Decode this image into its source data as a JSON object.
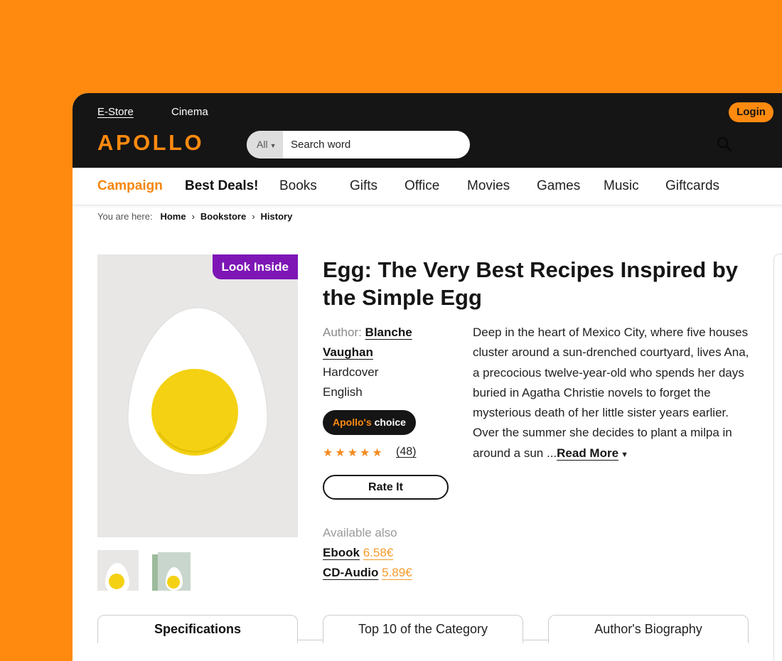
{
  "topbar": {
    "links": [
      "E-Store",
      "Cinema"
    ],
    "login_label": "Login",
    "logo": "APOLLO",
    "search": {
      "scope": "All",
      "placeholder": "Search word"
    }
  },
  "nav": {
    "items": [
      "Campaign",
      "Best Deals!",
      "Books",
      "Gifts",
      "Office",
      "Movies",
      "Games",
      "Music",
      "Giftcards"
    ]
  },
  "breadcrumb": {
    "prefix": "You are here:",
    "items": [
      "Home",
      "Bookstore",
      "History"
    ]
  },
  "product": {
    "look_inside": "Look Inside",
    "title": "Egg: The Very Best Recipes Inspired by the Simple Egg",
    "author_label": "Author:",
    "author": "Blanche Vaughan",
    "binding": "Hardcover",
    "language": "English",
    "badge": {
      "brand": "Apollo's",
      "suffix": "choice"
    },
    "rating": {
      "stars": 5,
      "count": "(48)"
    },
    "rate_label": "Rate It",
    "available_label": "Available also",
    "formats": [
      {
        "name": "Ebook",
        "price": "6.58€"
      },
      {
        "name": "CD-Audio",
        "price": "5.89€"
      }
    ],
    "description": "Deep in the heart of Mexico City, where five houses cluster around a sun-drenched courtyard, lives Ana, a precocious twelve-year-old who spends her days buried in Agatha Christie novels to forget the mysterious death of her little sister years earlier. Over the summer she decides to plant a milpa in around a sun ...",
    "read_more": "Read More"
  },
  "tabs": [
    "Specifications",
    "Top 10 of the Category",
    "Author's Biography"
  ],
  "colors": {
    "accent": "#FF8A0F",
    "dark": "#151515",
    "purple": "#7D16B5",
    "star": "#F58A1F"
  }
}
